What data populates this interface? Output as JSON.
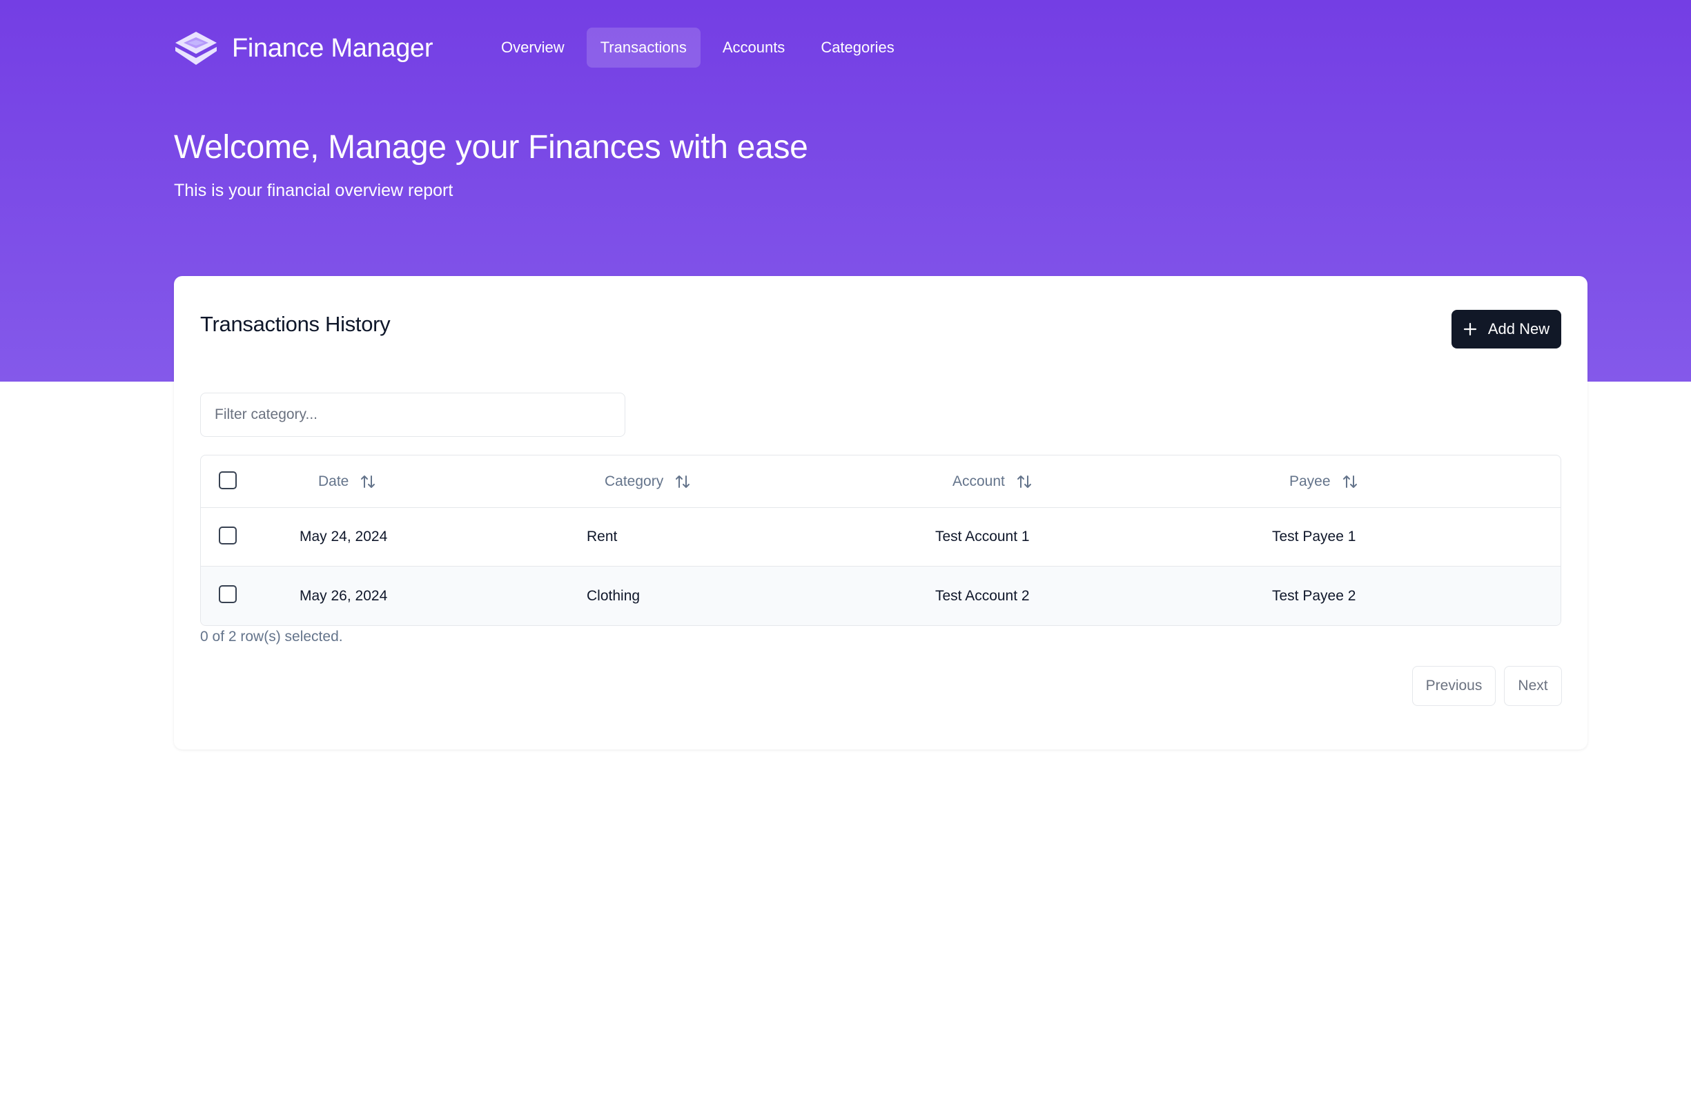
{
  "app": {
    "name": "Finance Manager"
  },
  "nav": {
    "items": [
      {
        "label": "Overview"
      },
      {
        "label": "Transactions"
      },
      {
        "label": "Accounts"
      },
      {
        "label": "Categories"
      }
    ],
    "active": "Transactions"
  },
  "hero": {
    "title": "Welcome, Manage your Finances with ease",
    "subtitle": "This is your financial overview report"
  },
  "card": {
    "title": "Transactions History",
    "add_button_label": "Add New",
    "filter_placeholder": "Filter category..."
  },
  "table": {
    "columns": [
      {
        "label": "Date"
      },
      {
        "label": "Category"
      },
      {
        "label": "Account"
      },
      {
        "label": "Payee"
      }
    ],
    "rows": [
      {
        "date": "May 24, 2024",
        "category": "Rent",
        "account": "Test Account 1",
        "payee": "Test Payee 1",
        "selected": false
      },
      {
        "date": "May 26, 2024",
        "category": "Clothing",
        "account": "Test Account 2",
        "payee": "Test Payee 2",
        "selected": false
      }
    ],
    "selection_text": "0 of 2 row(s) selected."
  },
  "pagination": {
    "previous_label": "Previous",
    "next_label": "Next"
  },
  "icons": {
    "logo": "layers-logo-icon",
    "add": "plus-icon",
    "sort": "arrow-up-down-icon"
  },
  "colors": {
    "hero_gradient_start": "#743ee4",
    "hero_gradient_end": "#8459ea",
    "primary_button": "#111827"
  }
}
